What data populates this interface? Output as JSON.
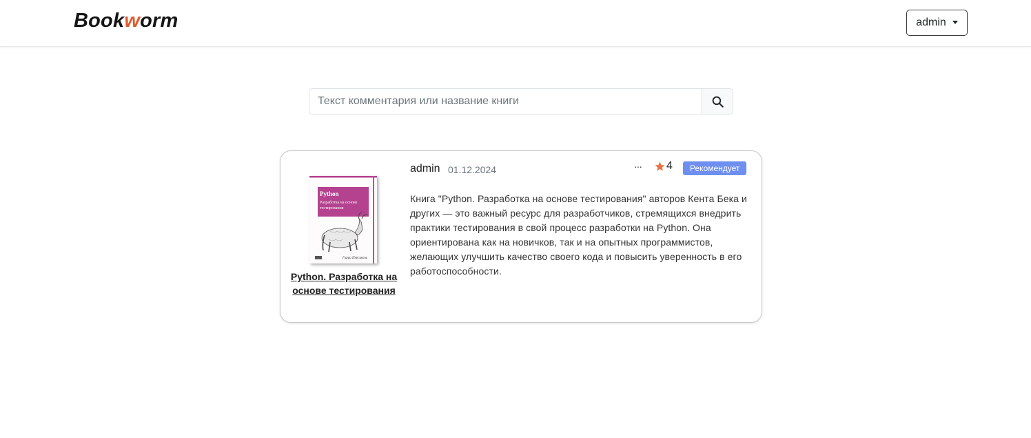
{
  "navbar": {
    "brand_part1": "Book",
    "brand_accent": "w",
    "brand_part2": "orm",
    "user_menu_label": "admin",
    "accent_color": "#e15a2d"
  },
  "search": {
    "placeholder": "Текст комментария или название книги",
    "value": "",
    "icon": "search-icon"
  },
  "reviews": [
    {
      "author": "admin",
      "date": "01.12.2024",
      "more_label": "···",
      "rating": "4",
      "badge": "Рекомендует",
      "book_title": "Python. Разработка на основе тестирования",
      "cover": {
        "title_line1": "Python",
        "title_line2": "Разработка на основе",
        "title_line3": "тестирования",
        "author": "Гарри Персиваль",
        "accent_color": "#b5428f"
      },
      "text": "Книга \"Python. Разработка на основе тестирования\" авторов Кента Бека и других — это важный ресурс для разработчиков, стремящихся внедрить практики тестирования в свой процесс разработки на Python. Она ориентирована как на новичков, так и на опытных программистов, желающих улучшить качество своего кода и повысить уверенность в его работоспособности."
    }
  ],
  "colors": {
    "badge": "#6e8ff0",
    "star": "#e8734a"
  }
}
